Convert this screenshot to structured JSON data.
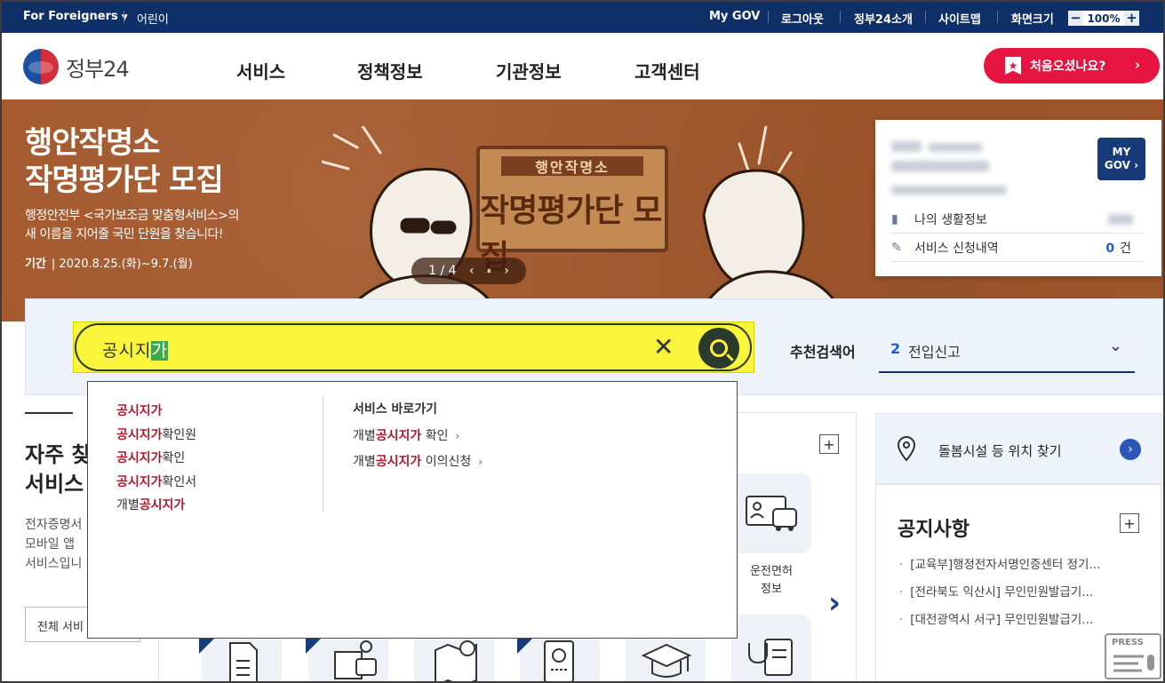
{
  "topbar": {
    "foreigners": "For Foreigners",
    "kids": "어린이",
    "mygov": "My GOV",
    "logout": "로그아웃",
    "intro": "정부24소개",
    "sitemap": "사이트맵",
    "screen_size": "화면크기",
    "zoom_minus": "−",
    "zoom_value": "100%",
    "zoom_plus": "+"
  },
  "header": {
    "logo_text": "정부24",
    "nav": [
      "서비스",
      "정책정보",
      "기관정보",
      "고객센터"
    ],
    "first_visit": "처음오셨나요?",
    "first_visit_chevron": "›"
  },
  "banner": {
    "title_line1": "행안작명소",
    "title_line2": "작명평가단 모집",
    "desc_line1": "행정안전부 <국가보조금 맞춤형서비스>의",
    "desc_line2": "새 이름을 지어줄 국민 단원을 찾습니다!",
    "period_label": "기간",
    "period_value": "| 2020.8.25.(화)~9.7.(월)",
    "sign_top": "행안작명소",
    "sign_main": "작명평가단 모집",
    "slide_indicator": "1 / 4",
    "prev": "‹",
    "pause": "⏸",
    "next": "›"
  },
  "mycard": {
    "mygov_line1": "MY",
    "mygov_line2": "GOV ›",
    "row1_label": "나의 생활정보",
    "row2_label": "서비스 신청내역",
    "row2_count": "0",
    "row2_unit": "건"
  },
  "search": {
    "query_plain": "공시지",
    "query_highlight": "가",
    "clear": "✕",
    "rec_label": "추천검색어",
    "rec_num": "2",
    "rec_keyword": "전입신고",
    "rec_chevron": "⌄"
  },
  "autocomplete": {
    "suggestions": [
      {
        "pre": "",
        "match": "공시지가",
        "post": ""
      },
      {
        "pre": "",
        "match": "공시지가",
        "post": "확인원"
      },
      {
        "pre": "",
        "match": "공시지가",
        "post": "확인"
      },
      {
        "pre": "",
        "match": "공시지가",
        "post": "확인서"
      },
      {
        "pre": "개별",
        "match": "공시지가",
        "post": ""
      }
    ],
    "shortcut_title": "서비스 바로가기",
    "shortcuts": [
      {
        "pre": "개별",
        "match": "공시지가",
        "post": " 확인",
        "arrow": "›"
      },
      {
        "pre": "개별",
        "match": "공시지가",
        "post": " 이의신청",
        "arrow": "›"
      }
    ]
  },
  "freq": {
    "title_line1": "자주 찾",
    "title_line2": "서비스",
    "desc_line1": "전자증명서",
    "desc_line2": "모바일 앱",
    "desc_line3": "서비스입니",
    "all_button": "전체 서비"
  },
  "center": {
    "plus": "+",
    "tile_label_line1": "운전면허",
    "tile_label_line2": "정보",
    "next": "›"
  },
  "right": {
    "care_label": "돌봄시설 등 위치 찾기",
    "care_go": "›",
    "notice_title": "공지사항",
    "notice_plus": "+",
    "notices": [
      "[교육부]행정전자서명인증센터 정기...",
      "[전라북도 익산시] 무인민원발급기...",
      "[대전광역시 서구] 무인민원발급기..."
    ],
    "press": "PRESS"
  },
  "colors": {
    "topbar": "#0f2f67",
    "accent_red": "#e5153f",
    "banner": "#a4582c",
    "search_highlight": "#faf53a",
    "match_red": "#b0182c"
  }
}
